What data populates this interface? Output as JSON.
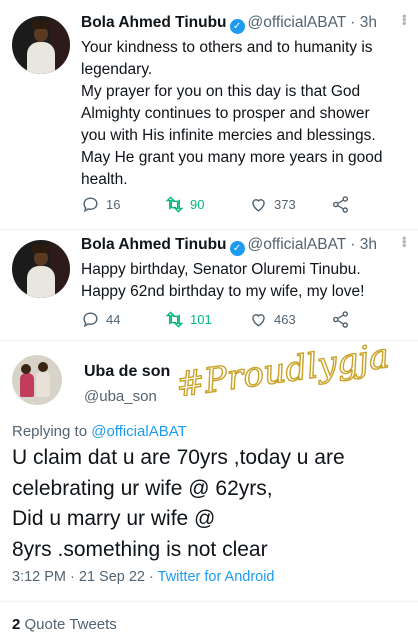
{
  "tweets": [
    {
      "name": "Bola Ahmed Tinubu",
      "handle": "@officialABAT",
      "sep": "·",
      "time": "3h",
      "text": [
        "Your kindness to others and to humanity is",
        "legendary.",
        "My prayer for you on this day is that God",
        "Almighty continues to prosper and shower",
        "you with His infinite mercies and blessings.",
        "May He grant you many more years in good",
        "health."
      ],
      "replies": "16",
      "retweets": "90",
      "likes": "373"
    },
    {
      "name": "Bola Ahmed Tinubu",
      "handle": "@officialABAT",
      "sep": "·",
      "time": "3h",
      "text": [
        "Happy birthday, Senator Oluremi Tinubu.",
        "Happy 62nd birthday to my wife, my love!"
      ],
      "replies": "44",
      "retweets": "101",
      "likes": "463"
    }
  ],
  "main_tweet": {
    "name": "Uba de son",
    "handle": "@uba_son",
    "replying_prefix": "Replying to",
    "replying_to": "@officialABAT",
    "text": [
      "U claim dat u are 70yrs ,today u are",
      "celebrating ur wife @ 62yrs,",
      "Did u marry ur wife @",
      "8yrs .something is not clear"
    ],
    "timestamp": "3:12 PM · 21 Sep 22 ·",
    "source": "Twitter for Android",
    "quote_count": "2",
    "quote_label": "Quote Tweets"
  },
  "watermark": {
    "text": "#Proudlygja"
  },
  "icons": {
    "verified": "verified-badge-icon",
    "reply": "reply-icon",
    "retweet": "retweet-icon",
    "like": "like-icon",
    "share": "share-icon",
    "more": "more-icon"
  },
  "colors": {
    "accent": "#1d9bf0",
    "retweet": "#00ba7c",
    "secondary_text": "#536471",
    "watermark": "#c9a227"
  }
}
